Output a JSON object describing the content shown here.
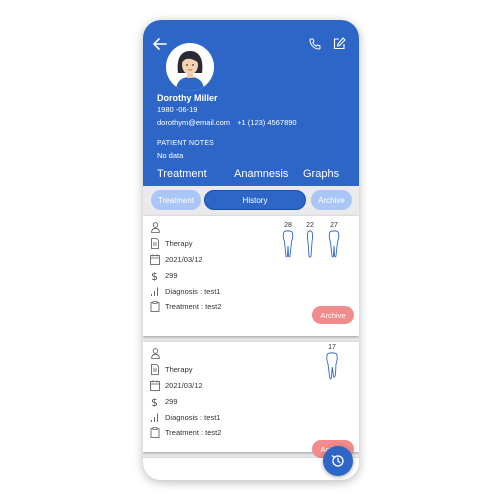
{
  "patient": {
    "name": "Dorothy Miller",
    "dob": "1980 -06-19",
    "email": "dorothym@email.com",
    "phone": "+1 (123) 4567890",
    "notes_label": "PATIENT NOTES",
    "notes_value": "No data"
  },
  "tabs": [
    "Treatment",
    "Anamnesis",
    "Graphs"
  ],
  "subtabs": {
    "treatment": "Treatment",
    "history": "History",
    "archive": "Archive"
  },
  "records": [
    {
      "type": "Therapy",
      "date": "2021/03/12",
      "amount": "299",
      "diagnosis": "Diagnosis : test1",
      "treatment": "Treatment : test2",
      "teeth": [
        "28",
        "22",
        "27"
      ],
      "archive_label": "Archive"
    },
    {
      "type": "Therapy",
      "date": "2021/03/12",
      "amount": "299",
      "diagnosis": "Diagnosis : test1",
      "treatment": "Treatment : test2",
      "teeth": [
        "17"
      ],
      "archive_label": "Archive"
    }
  ],
  "colors": {
    "primary": "#2e66c7",
    "light_pill": "#a9c6f5",
    "archive": "#f28b8b"
  },
  "icons": [
    "back-arrow-icon",
    "phone-icon",
    "edit-icon",
    "user-icon",
    "document-icon",
    "calendar-icon",
    "dollar-icon",
    "bars-icon",
    "clipboard-icon",
    "tooth-icon",
    "history-icon"
  ]
}
